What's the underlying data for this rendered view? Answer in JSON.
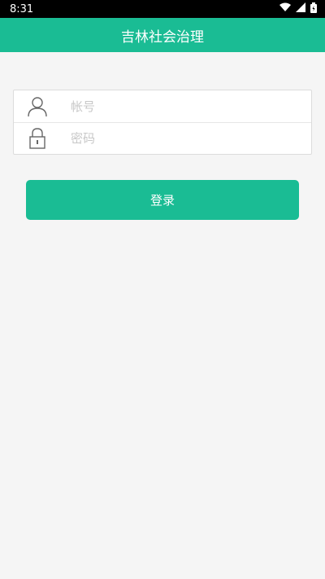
{
  "status_bar": {
    "time": "8:31",
    "icons": [
      "wifi-icon",
      "signal-icon",
      "battery-icon"
    ]
  },
  "app_bar": {
    "title": "吉林社会治理"
  },
  "login_form": {
    "account": {
      "placeholder": "帐号",
      "value": "",
      "icon": "user-icon"
    },
    "password": {
      "placeholder": "密码",
      "value": "",
      "icon": "lock-icon"
    }
  },
  "login_button": {
    "label": "登录"
  },
  "colors": {
    "accent": "#1abc94",
    "background": "#f5f5f5"
  }
}
